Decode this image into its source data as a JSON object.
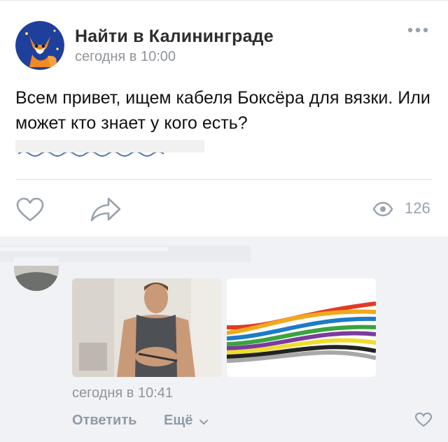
{
  "post": {
    "group_name": "Найти в Калининграде",
    "time": "сегодня в 10:00",
    "text": "Всем привет, ищем кабеля Боксёра для вязки. Или может кто знает у кого есть?",
    "views": "126",
    "icons": {
      "more": "more-dots-icon",
      "like": "heart-icon",
      "share": "share-icon",
      "views": "eye-icon"
    }
  },
  "comment": {
    "time": "сегодня в 10:41",
    "reply_label": "Ответить",
    "more_label": "Ещё",
    "icons": {
      "more_chevron": "chevron-down-icon",
      "like": "heart-icon"
    }
  },
  "colors": {
    "link_gray": "#8f9aa8",
    "meta_gray": "#909499",
    "comments_background": "#f0f2f5",
    "icon_gray": "#99a2ad"
  }
}
